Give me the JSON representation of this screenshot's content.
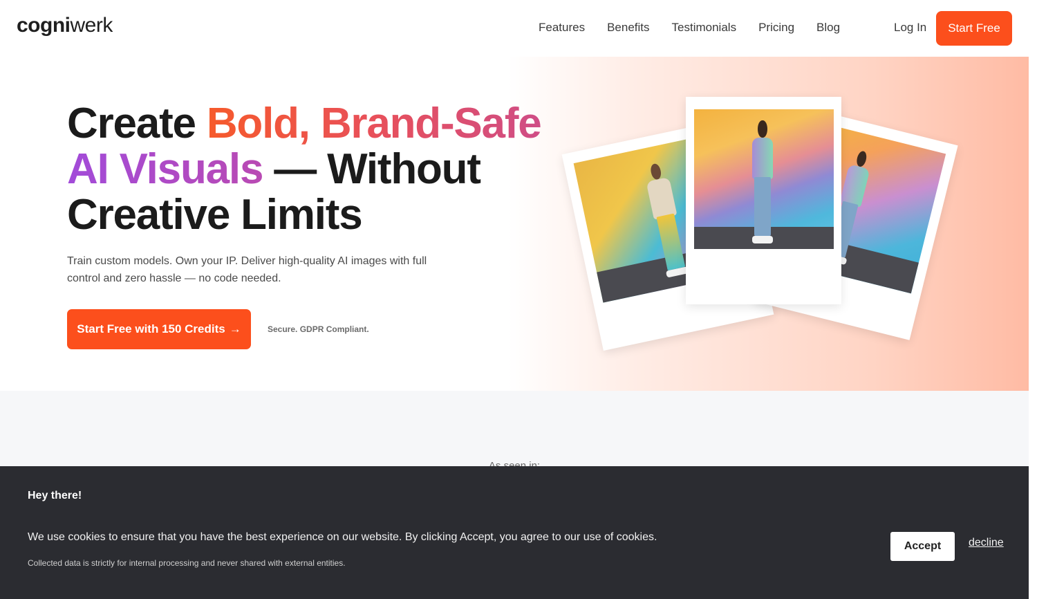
{
  "header": {
    "logo_bold": "cogni",
    "logo_light": "werk",
    "nav": [
      "Features",
      "Benefits",
      "Testimonials",
      "Pricing",
      "Blog"
    ],
    "login": "Log In",
    "start_free": "Start Free"
  },
  "hero": {
    "headline": {
      "part1": "Create ",
      "part2": "Bold, Brand-Safe",
      "part3": "AI Visuals",
      "part4": " — Without",
      "part5": "Creative Limits"
    },
    "subtext": "Train custom models. Own your IP. Deliver high-quality AI images with full control and zero hassle — no code needed.",
    "cta_label": "Start Free with 150 Credits",
    "cta_arrow": "→",
    "secure_note": "Secure. GDPR Compliant."
  },
  "section2": {
    "seen_in": "As seen in:"
  },
  "cookie": {
    "title": "Hey there!",
    "text": "We use cookies to ensure that you have the best experience on our website. By clicking Accept, you agree to our use of cookies.",
    "note": "Collected data is strictly for internal processing and never shared with external entities.",
    "accept": "Accept",
    "decline": "decline"
  },
  "colors": {
    "brand_orange": "#fc4f1c",
    "cookie_bg": "#2b2c31"
  }
}
